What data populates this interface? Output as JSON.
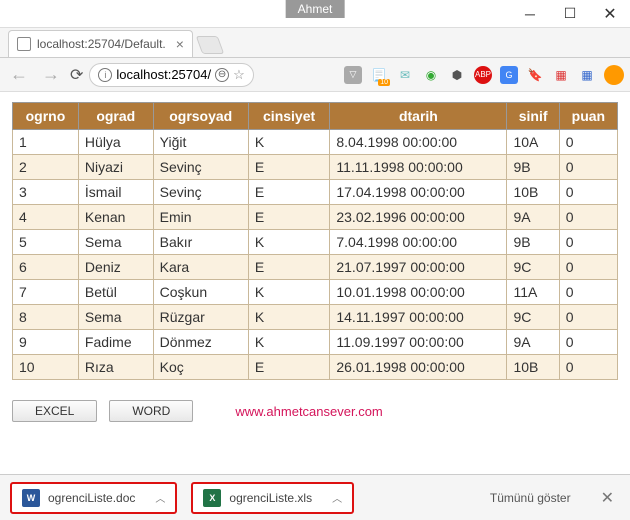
{
  "titlebar": {
    "user": "Ahmet"
  },
  "tab": {
    "title": "localhost:25704/Default."
  },
  "addrbar": {
    "url": "localhost:25704/"
  },
  "table": {
    "headers": [
      "ogrno",
      "ograd",
      "ogrsoyad",
      "cinsiyet",
      "dtarih",
      "sinif",
      "puan"
    ],
    "rows": [
      [
        "1",
        "Hülya",
        "Yiğit",
        "K",
        "8.04.1998 00:00:00",
        "10A",
        "0"
      ],
      [
        "2",
        "Niyazi",
        "Sevinç",
        "E",
        "11.11.1998 00:00:00",
        "9B",
        "0"
      ],
      [
        "3",
        "İsmail",
        "Sevinç",
        "E",
        "17.04.1998 00:00:00",
        "10B",
        "0"
      ],
      [
        "4",
        "Kenan",
        "Emin",
        "E",
        "23.02.1996 00:00:00",
        "9A",
        "0"
      ],
      [
        "5",
        "Sema",
        "Bakır",
        "K",
        "7.04.1998 00:00:00",
        "9B",
        "0"
      ],
      [
        "6",
        "Deniz",
        "Kara",
        "E",
        "21.07.1997 00:00:00",
        "9C",
        "0"
      ],
      [
        "7",
        "Betül",
        "Coşkun",
        "K",
        "10.01.1998 00:00:00",
        "11A",
        "0"
      ],
      [
        "8",
        "Sema",
        "Rüzgar",
        "K",
        "14.11.1997 00:00:00",
        "9C",
        "0"
      ],
      [
        "9",
        "Fadime",
        "Dönmez",
        "K",
        "11.09.1997 00:00:00",
        "9A",
        "0"
      ],
      [
        "10",
        "Rıza",
        "Koç",
        "E",
        "26.01.1998 00:00:00",
        "10B",
        "0"
      ]
    ]
  },
  "buttons": {
    "excel": "EXCEL",
    "word": "WORD"
  },
  "site_link": "www.ahmetcansever.com",
  "downloads": {
    "doc": "ogrenciListe.doc",
    "xls": "ogrenciListe.xls",
    "showall": "Tümünü göster"
  }
}
